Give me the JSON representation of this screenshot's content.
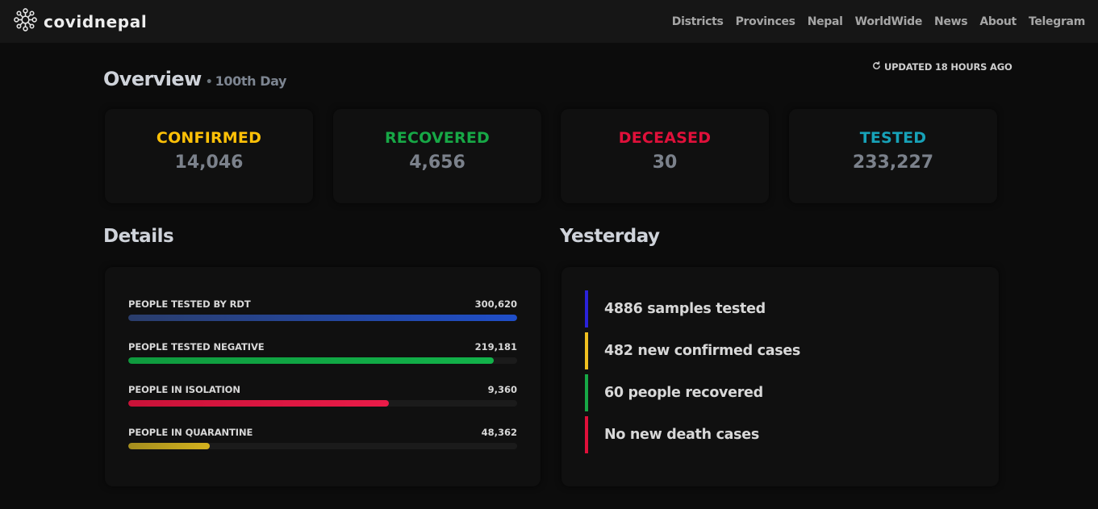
{
  "brand": {
    "name": "covidnepal",
    "icon": "virus-logo-icon"
  },
  "nav": [
    "Districts",
    "Provinces",
    "Nepal",
    "WorldWide",
    "News",
    "About",
    "Telegram"
  ],
  "overview": {
    "title": "Overview",
    "bullet": "•",
    "day": "100th Day",
    "updated": "UPDATED 18 HOURS AGO",
    "updated_icon": "refresh-icon"
  },
  "stats": [
    {
      "label": "CONFIRMED",
      "value": "14,046",
      "color": "#ffc107"
    },
    {
      "label": "RECOVERED",
      "value": "4,656",
      "color": "#17a846"
    },
    {
      "label": "DECEASED",
      "value": "30",
      "color": "#e0103a"
    },
    {
      "label": "TESTED",
      "value": "233,227",
      "color": "#17a2b8"
    }
  ],
  "details": {
    "title": "Details",
    "rows": [
      {
        "label": "PEOPLE TESTED BY RDT",
        "value": "300,620",
        "fraction": 1.0,
        "color_start": "#2a3d6b",
        "color_end": "#1f4ec9"
      },
      {
        "label": "PEOPLE TESTED NEGATIVE",
        "value": "219,181",
        "fraction": 0.94,
        "color_start": "#0f9a3e",
        "color_end": "#12b24a"
      },
      {
        "label": "PEOPLE IN ISOLATION",
        "value": "9,360",
        "fraction": 0.671,
        "color_start": "#c91238",
        "color_end": "#ea1b48"
      },
      {
        "label": "PEOPLE IN QUARANTINE",
        "value": "48,362",
        "fraction": 0.209,
        "color_start": "#a48d1e",
        "color_end": "#d4b21e"
      }
    ]
  },
  "yesterday": {
    "title": "Yesterday",
    "items": [
      {
        "text": "4886 samples tested",
        "color": "#2a22d8"
      },
      {
        "text": "482 new confirmed cases",
        "color": "#f0c020"
      },
      {
        "text": "60 people recovered",
        "color": "#17a846"
      },
      {
        "text": "No new death cases",
        "color": "#e0103a"
      }
    ]
  }
}
